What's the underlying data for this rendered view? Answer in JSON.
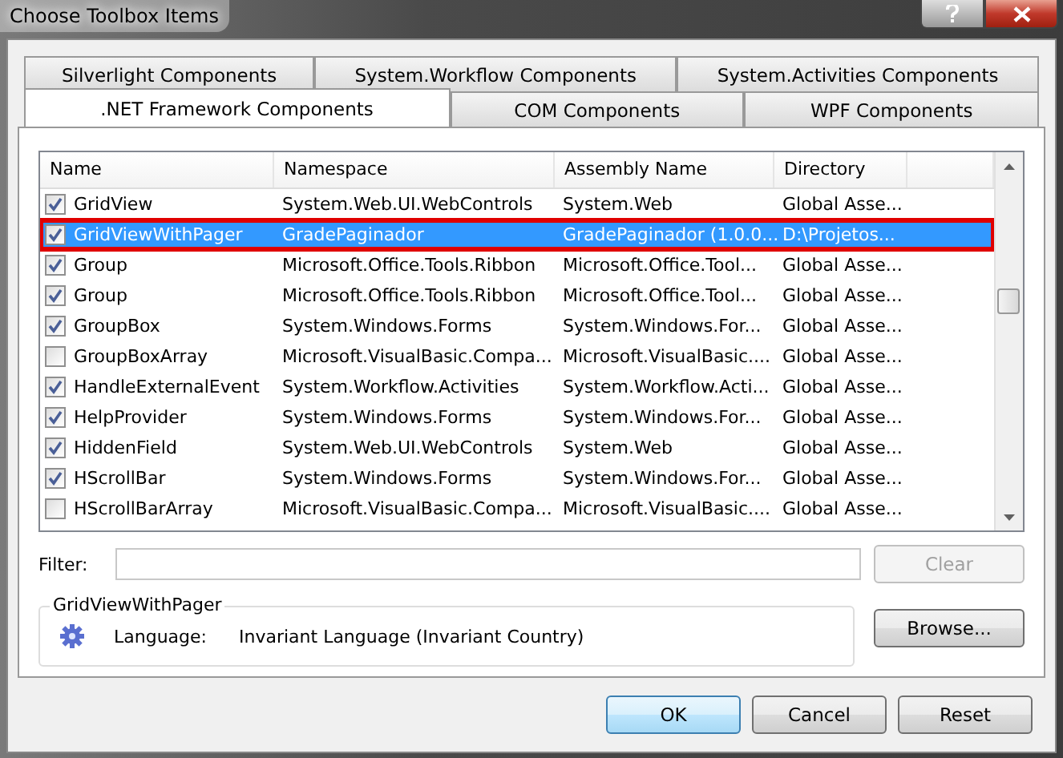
{
  "window": {
    "title": "Choose Toolbox Items"
  },
  "tabs": [
    [
      {
        "label": "Silverlight Components",
        "selected": false
      },
      {
        "label": "System.Workflow Components",
        "selected": false
      },
      {
        "label": "System.Activities Components",
        "selected": false
      }
    ],
    [
      {
        "label": ".NET Framework Components",
        "selected": true
      },
      {
        "label": "COM Components",
        "selected": false
      },
      {
        "label": "WPF Components",
        "selected": false
      }
    ]
  ],
  "table": {
    "columns": [
      "Name",
      "Namespace",
      "Assembly Name",
      "Directory"
    ],
    "rows": [
      {
        "checked": true,
        "selected": false,
        "annotated": false,
        "cells": [
          "GridView",
          "System.Web.UI.WebControls",
          "System.Web",
          "Global Asse..."
        ]
      },
      {
        "checked": true,
        "selected": true,
        "annotated": true,
        "cells": [
          "GridViewWithPager",
          "GradePaginador",
          "GradePaginador (1.0.0...",
          "D:\\Projetos..."
        ]
      },
      {
        "checked": true,
        "selected": false,
        "annotated": false,
        "cells": [
          "Group",
          "Microsoft.Office.Tools.Ribbon",
          "Microsoft.Office.Tool...",
          "Global Asse..."
        ]
      },
      {
        "checked": true,
        "selected": false,
        "annotated": false,
        "cells": [
          "Group",
          "Microsoft.Office.Tools.Ribbon",
          "Microsoft.Office.Tool...",
          "Global Asse..."
        ]
      },
      {
        "checked": true,
        "selected": false,
        "annotated": false,
        "cells": [
          "GroupBox",
          "System.Windows.Forms",
          "System.Windows.For...",
          "Global Asse..."
        ]
      },
      {
        "checked": false,
        "selected": false,
        "annotated": false,
        "cells": [
          "GroupBoxArray",
          "Microsoft.VisualBasic.Compa...",
          "Microsoft.VisualBasic....",
          "Global Asse..."
        ]
      },
      {
        "checked": true,
        "selected": false,
        "annotated": false,
        "cells": [
          "HandleExternalEvent",
          "System.Workflow.Activities",
          "System.Workflow.Acti...",
          "Global Asse..."
        ]
      },
      {
        "checked": true,
        "selected": false,
        "annotated": false,
        "cells": [
          "HelpProvider",
          "System.Windows.Forms",
          "System.Windows.For...",
          "Global Asse..."
        ]
      },
      {
        "checked": true,
        "selected": false,
        "annotated": false,
        "cells": [
          "HiddenField",
          "System.Web.UI.WebControls",
          "System.Web",
          "Global Asse..."
        ]
      },
      {
        "checked": true,
        "selected": false,
        "annotated": false,
        "cells": [
          "HScrollBar",
          "System.Windows.Forms",
          "System.Windows.For...",
          "Global Asse..."
        ]
      },
      {
        "checked": false,
        "selected": false,
        "annotated": false,
        "cells": [
          "HScrollBarArray",
          "Microsoft.VisualBasic.Compa...",
          "Microsoft.VisualBasic....",
          "Global Asse..."
        ]
      }
    ]
  },
  "filter": {
    "label": "Filter:",
    "clear_button": "Clear",
    "clear_disabled": true
  },
  "details": {
    "title": "GridViewWithPager",
    "label": "Language:",
    "value": "Invariant Language (Invariant Country)"
  },
  "browse_button": "Browse...",
  "buttons": [
    {
      "label": "OK",
      "default": true
    },
    {
      "label": "Cancel",
      "default": false
    },
    {
      "label": "Reset",
      "default": false
    }
  ]
}
